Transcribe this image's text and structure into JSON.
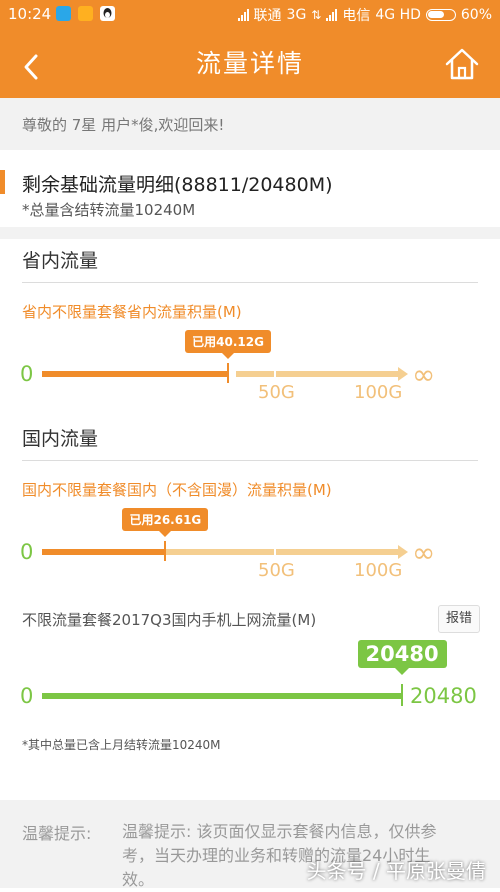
{
  "status_bar": {
    "time": "10:24",
    "carrier1": "联通",
    "net1": "3G",
    "carrier2": "电信",
    "net2": "4G HD",
    "battery": "60%"
  },
  "header": {
    "title": "流量详情"
  },
  "welcome": "尊敬的 7星 用户*俊,欢迎回来!",
  "balance": {
    "title": "剩余基础流量明细(88811/20480M)",
    "subtitle": "*总量含结转流量10240M"
  },
  "sections": [
    {
      "heading": "省内流量",
      "package_label": "省内不限量套餐省内流量积量(M)",
      "used_label": "已用40.12G",
      "used_fraction": 0.4012,
      "start": "0",
      "mark1": "50G",
      "mark2": "100G",
      "infinity": "∞"
    },
    {
      "heading": "国内流量",
      "package_label": "国内不限量套餐国内（不含国漫）流量积量(M)",
      "used_label": "已用26.61G",
      "used_fraction": 0.2661,
      "start": "0",
      "mark1": "50G",
      "mark2": "100G",
      "infinity": "∞"
    }
  ],
  "q3": {
    "label": "不限流量套餐2017Q3国内手机上网流量(M)",
    "report_button": "报错",
    "start": "0",
    "value_bubble": "20480",
    "end": "20480",
    "fraction": 1.0
  },
  "footnote": "*其中总量已含上月结转流量10240M",
  "tips": {
    "head": "温馨提示:",
    "body": "温馨提示: 该页面仅显示套餐内信息，仅供参考，当天办理的业务和转赠的流量24小时生效。"
  },
  "watermark": "头条号 / 平原张曼倩",
  "colors": {
    "brand": "#f08c2a",
    "light": "#f5cf91",
    "green": "#7cc644"
  }
}
